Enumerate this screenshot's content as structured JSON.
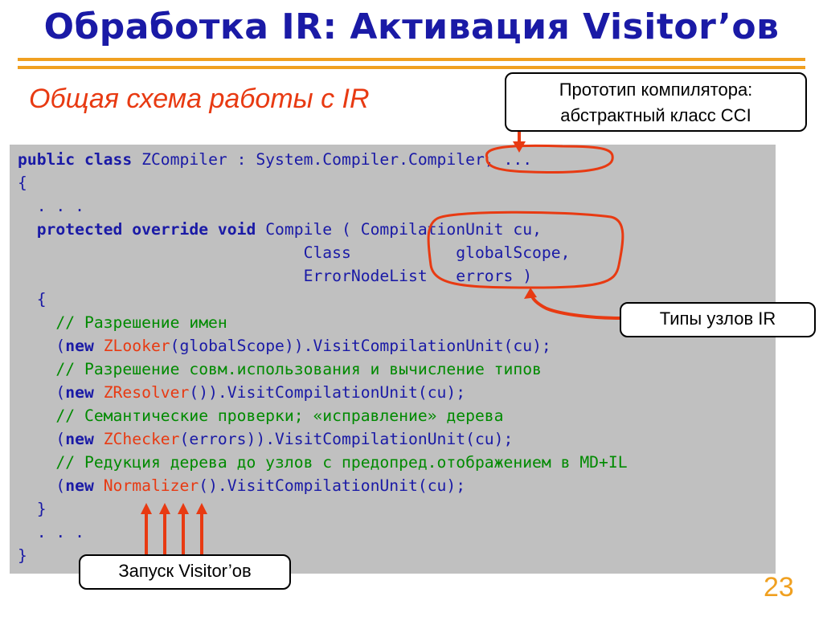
{
  "slide": {
    "title": "Обработка IR: Активация Visitor’ов",
    "subtitle": "Общая схема работы с IR",
    "page_number": "23"
  },
  "callouts": {
    "prototype_line1": "Прототип компилятора:",
    "prototype_line2": "абстрактный класс CCI",
    "ir_node_types": "Типы узлов IR",
    "visitor_launch": "Запуск Visitor’ов"
  },
  "code": {
    "l1_kw": "public class ",
    "l1_rest": "ZCompiler : System.Compiler.Compiler, ...",
    "l2": "{",
    "l3": "  . . .",
    "l4_kw": "  protected override void ",
    "l4_rest": "Compile ( CompilationUnit cu,",
    "l5": "                              Class           globalScope,",
    "l6": "                              ErrorNodeList   errors )",
    "l7": "  {",
    "l8": "    // Разрешение имен",
    "l9_a": "    (",
    "l9_kw": "new ",
    "l9_cls": "ZLooker",
    "l9_b": "(globalScope)).VisitCompilationUnit(cu);",
    "l10": "    // Разрешение совм.использования и вычисление типов",
    "l11_a": "    (",
    "l11_kw": "new ",
    "l11_cls": "ZResolver",
    "l11_b": "()).VisitCompilationUnit(cu);",
    "l12": "    // Семантические проверки; «исправление» дерева",
    "l13_a": "    (",
    "l13_kw": "new ",
    "l13_cls": "ZChecker",
    "l13_b": "(errors)).VisitCompilationUnit(cu);",
    "l14": "    // Редукция дерева до узлов с предопред.отображением в MD+IL",
    "l15_a": "    (",
    "l15_kw": "new ",
    "l15_cls": "Normalizer",
    "l15_b": "().VisitCompilationUnit(cu);",
    "l16": "  }",
    "l17": "  . . .",
    "l18": "}"
  },
  "colors": {
    "title": "#1a1aa6",
    "accent_red": "#e83a12",
    "rule_orange": "#f0a020",
    "comment_green": "#008a00",
    "code_background": "#c0c0c0"
  }
}
